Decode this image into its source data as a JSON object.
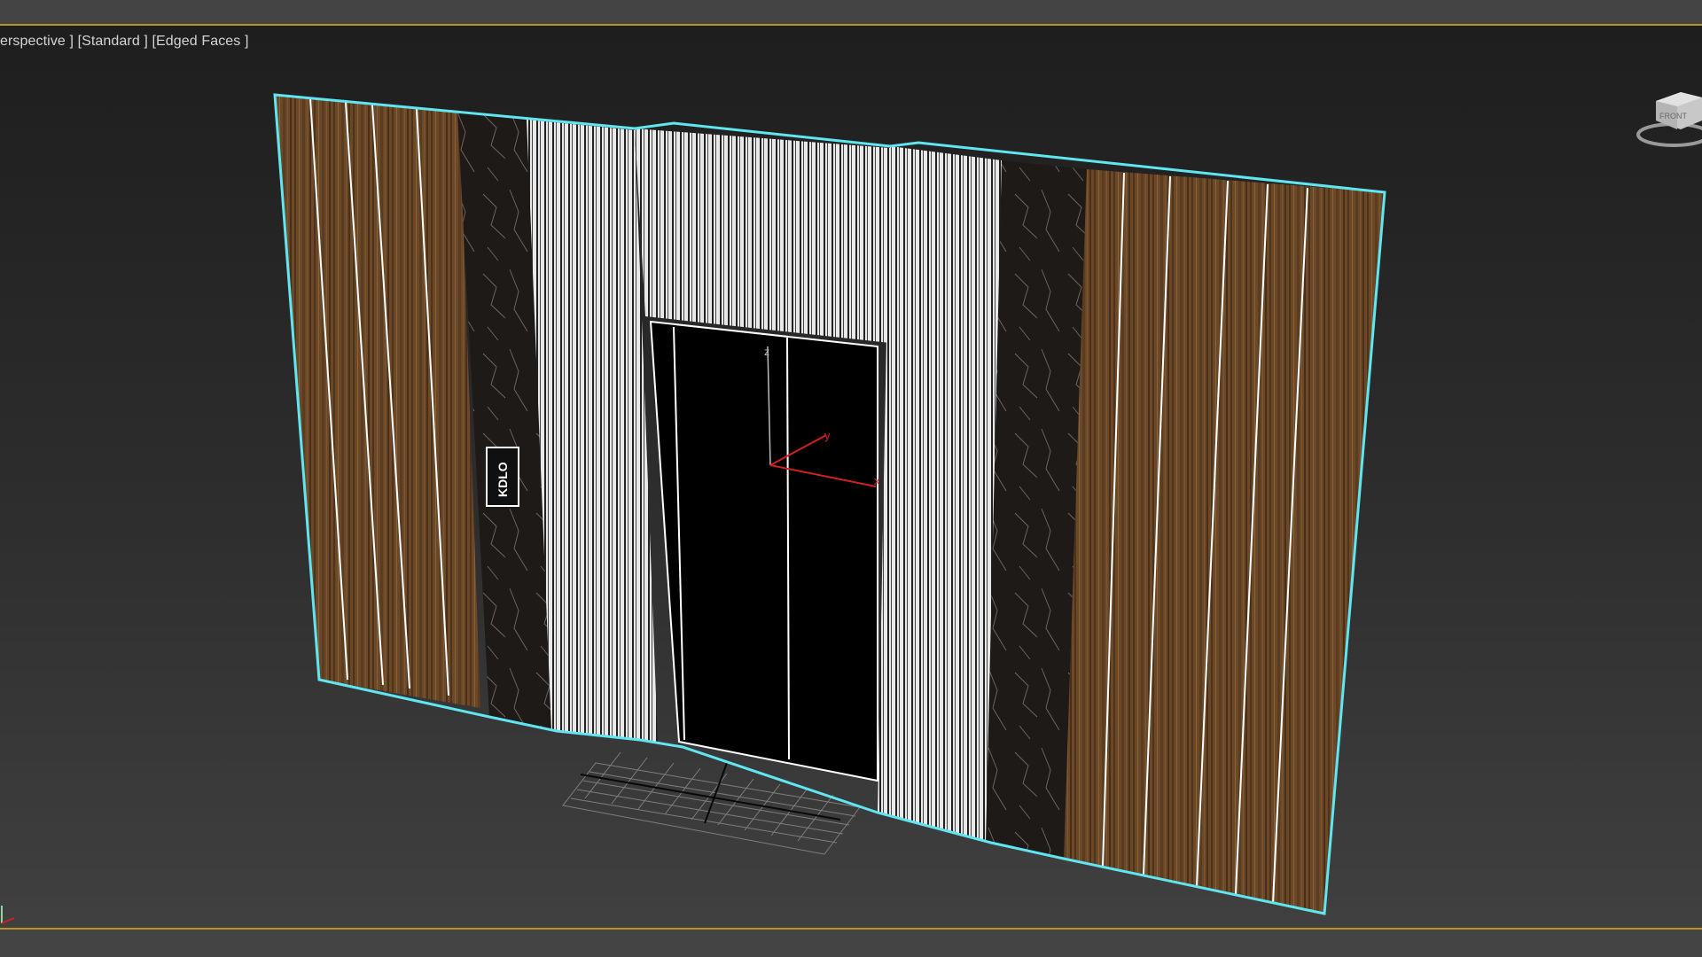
{
  "viewport": {
    "label_view": "erspective ]",
    "label_shading": "[Standard ]",
    "label_mode": "[Edged Faces ]"
  },
  "scene": {
    "panel_sign_text": "KDLO",
    "gizmo_axes": {
      "x": "x",
      "y": "y",
      "z": "z"
    }
  },
  "viewcube": {
    "face_label": "FRONT"
  },
  "colors": {
    "selection_outline": "#5fe6f0",
    "viewport_border": "#b99424",
    "wood": "#6b4a2a",
    "marble": "#1f1b19",
    "axis_red": "#d02020"
  },
  "icons": {
    "viewcube": "viewcube-icon",
    "world_axis": "world-axis-icon",
    "transform_gizmo": "transform-gizmo-icon"
  }
}
